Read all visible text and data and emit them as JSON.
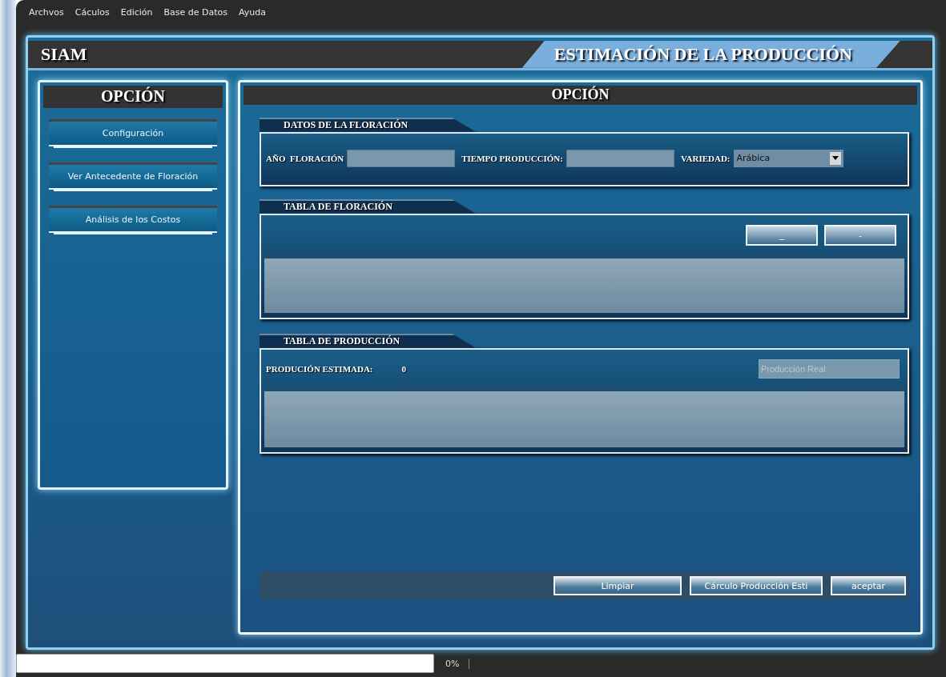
{
  "menu": [
    "Archvos",
    "Cáculos",
    "Edición",
    "Base de Datos",
    "Ayuda"
  ],
  "header": {
    "app_name": "SIAM",
    "title": "ESTIMACIÓN DE LA PRODUCCIÓN"
  },
  "sidebar": {
    "title": "OPCIÓN",
    "items": [
      "Configuración",
      "Ver Antecedente de Floración",
      "Análisis de los Costos"
    ]
  },
  "main": {
    "title": "OPCIÓN",
    "datos": {
      "tab": "DATOS DE LA FLORACIÓN",
      "fields": [
        {
          "kind": "text",
          "label": "AÑO  FLORACIÓN"
        },
        {
          "kind": "text",
          "label": "TIEMPO PRODUCCIÓN:"
        },
        {
          "kind": "select",
          "label": "VARIEDAD:",
          "value": "Arábica"
        }
      ]
    },
    "tabla_floracion": {
      "tab": "TABLA DE FLORACIÓN",
      "buttons": [
        "_",
        "-"
      ]
    },
    "tabla_produccion": {
      "tab": "TABLA DE PRODUCCIÓN",
      "label": "PRODUCIÓN ESTIMADA:",
      "value": "0",
      "field": {
        "placeholder": "Producción Real"
      }
    },
    "actions": [
      "Limpiar",
      "Cárculo Producción Esti",
      "aceptar"
    ]
  },
  "status_bar": {
    "progress": "0%"
  }
}
